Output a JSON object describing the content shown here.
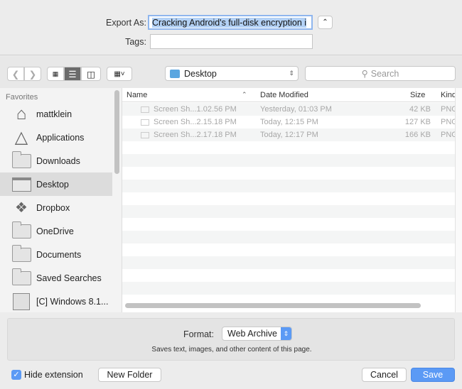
{
  "header": {
    "export_label": "Export As:",
    "export_value": "Cracking Android's full-disk encryption i",
    "tags_label": "Tags:",
    "tags_value": ""
  },
  "toolbar": {
    "location": "Desktop",
    "search_placeholder": "Search"
  },
  "sidebar": {
    "section": "Favorites",
    "items": [
      {
        "label": "mattklein",
        "icon": "home-icon"
      },
      {
        "label": "Applications",
        "icon": "applications-icon"
      },
      {
        "label": "Downloads",
        "icon": "folder-icon"
      },
      {
        "label": "Desktop",
        "icon": "desktop-icon",
        "selected": true
      },
      {
        "label": "Dropbox",
        "icon": "dropbox-icon"
      },
      {
        "label": "OneDrive",
        "icon": "folder-icon"
      },
      {
        "label": "Documents",
        "icon": "folder-icon"
      },
      {
        "label": "Saved Searches",
        "icon": "folder-icon"
      },
      {
        "label": "[C] Windows 8.1...",
        "icon": "drive-icon"
      }
    ]
  },
  "files": {
    "columns": {
      "name": "Name",
      "date": "Date Modified",
      "size": "Size",
      "kind": "Kind"
    },
    "rows": [
      {
        "name": "Screen Sh...1.02.56 PM",
        "date": "Yesterday, 01:03 PM",
        "size": "42 KB",
        "kind": "PNG i"
      },
      {
        "name": "Screen Sh...2.15.18 PM",
        "date": "Today, 12:15 PM",
        "size": "127 KB",
        "kind": "PNG i"
      },
      {
        "name": "Screen Sh...2.17.18 PM",
        "date": "Today, 12:17 PM",
        "size": "166 KB",
        "kind": "PNG i"
      }
    ]
  },
  "format": {
    "label": "Format:",
    "value": "Web Archive",
    "description": "Saves text, images, and other content of this page."
  },
  "footer": {
    "hide_extension": "Hide extension",
    "hide_extension_checked": true,
    "new_folder": "New Folder",
    "cancel": "Cancel",
    "save": "Save"
  },
  "colors": {
    "accent": "#5b9af5",
    "selection": "#b3d1f5"
  }
}
